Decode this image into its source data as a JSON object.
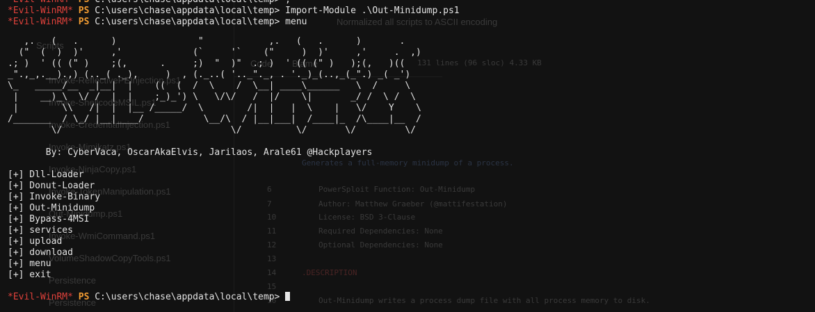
{
  "prompt": {
    "evil_label": "*Evil-WinRM*",
    "ps_label": "PS",
    "path": "C:\\users\\chase\\appdata\\local\\temp>"
  },
  "commands": {
    "partial": ";",
    "import": "Import-Module .\\Out-Minidump.ps1",
    "menu": "menu"
  },
  "banner_art": "   ,.   (   .      )               \"            ,.   (   .      )       .\n  (\"  (  )  )'     ,'             (`     '`    (\"     )  )'     ,'     .  ,)\n.; )  ' (( (\" )    ;(,      .     ;)  \"  )\"  .; )  ' (( (\" )   );(,   )((\n_\".,_,.__).,) (.._( ._),     )  , (._..( '.._\"._, . '._)_(..,_(_\".) _( _')\n\\_   _____/__  _|__|  |    ((  (  /  \\    /  \\__| ____\\______   \\  /     \\\n |    __)_\\  \\/ /  |  |    ;_)_') \\   \\/\\/   /  |/    \\|       _/ /  \\ /  \\\n |        \\\\   /|  |  |__ /_____/  \\        /|  |   |  \\    |   \\/    Y    \\\n/_______  / \\_/ |__|____/           \\__/\\  / |__|___|  /____|_  /\\____|__  /\n        \\/                               \\/          \\/       \\/         \\/",
  "credits": "       By: CyberVaca, OscarAkaElvis, Jarilaos, Arale61 @Hackplayers",
  "menu_items": [
    "[+] Dll-Loader",
    "[+] Donut-Loader",
    "[+] Invoke-Binary",
    "[+] Out-Minidump",
    "[+] Bypass-4MSI",
    "[+] services",
    "[+] upload",
    "[+] download",
    "[+] menu",
    "[+] exit"
  ]
}
